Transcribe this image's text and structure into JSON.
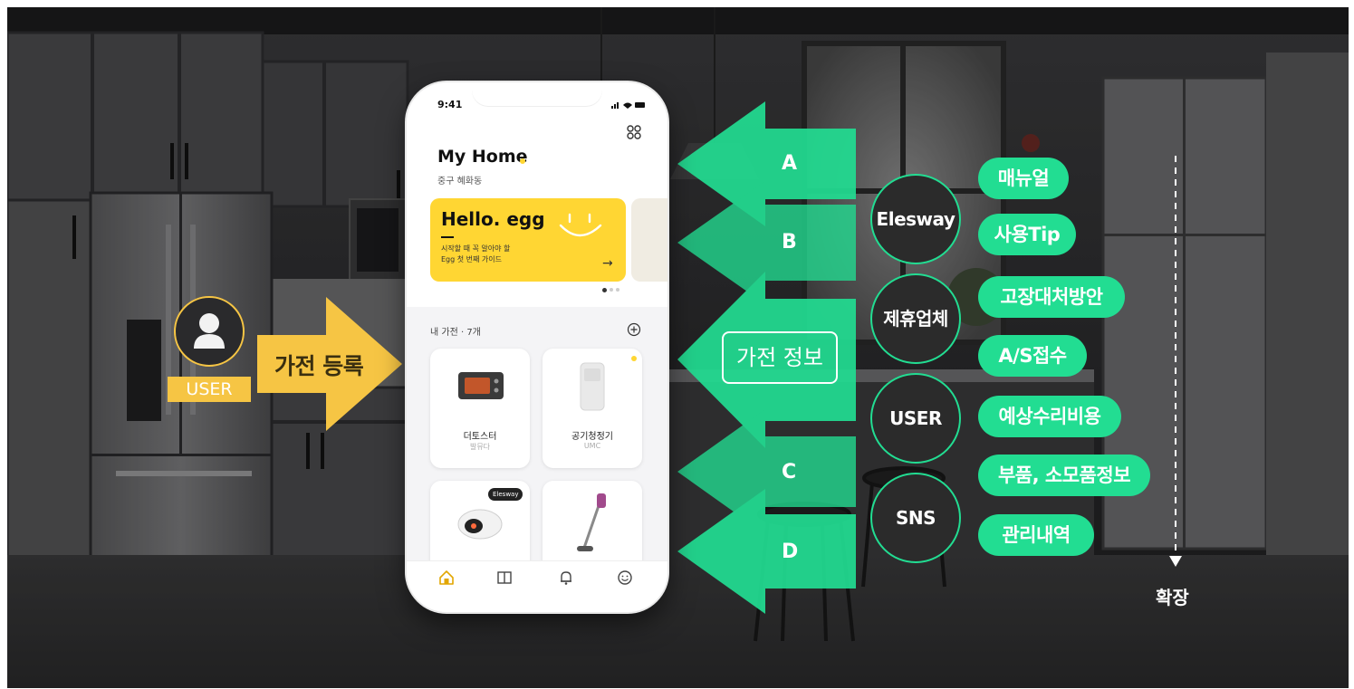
{
  "phone": {
    "status_time": "9:41",
    "home_title": "My Home",
    "home_location": "중구 혜화동",
    "banner": {
      "title": "Hello. egg",
      "line1": "시작할 때 꼭 알아야 할",
      "line2": "Egg 첫 번째 가이드"
    },
    "section_title": "내 가전 · 7개",
    "appliances": [
      {
        "name": "더토스터",
        "brand": "발뮤다"
      },
      {
        "name": "공기청정기",
        "brand": "UMC"
      },
      {
        "name": "",
        "brand": "",
        "badge": "Elesway"
      },
      {
        "name": "",
        "brand": ""
      }
    ],
    "nav_icons": [
      "home-icon",
      "book-icon",
      "bell-icon",
      "smile-icon"
    ]
  },
  "user": {
    "label": "USER",
    "register_label": "가전 등록"
  },
  "flow": {
    "letters": [
      "A",
      "B",
      "C",
      "D"
    ],
    "info_box": "가전 정보"
  },
  "sources": [
    "Elesway",
    "제휴업체",
    "USER",
    "SNS"
  ],
  "features": [
    "매뉴얼",
    "사용Tip",
    "고장대처방안",
    "A/S접수",
    "예상수리비용",
    "부품, 소모품정보",
    "관리내역"
  ],
  "expand_label": "확장",
  "colors": {
    "accent_green": "#22dd92",
    "banner_yellow": "#ffd633",
    "arrow_yellow": "#f6c544",
    "background_dark": "#2f2f31"
  }
}
